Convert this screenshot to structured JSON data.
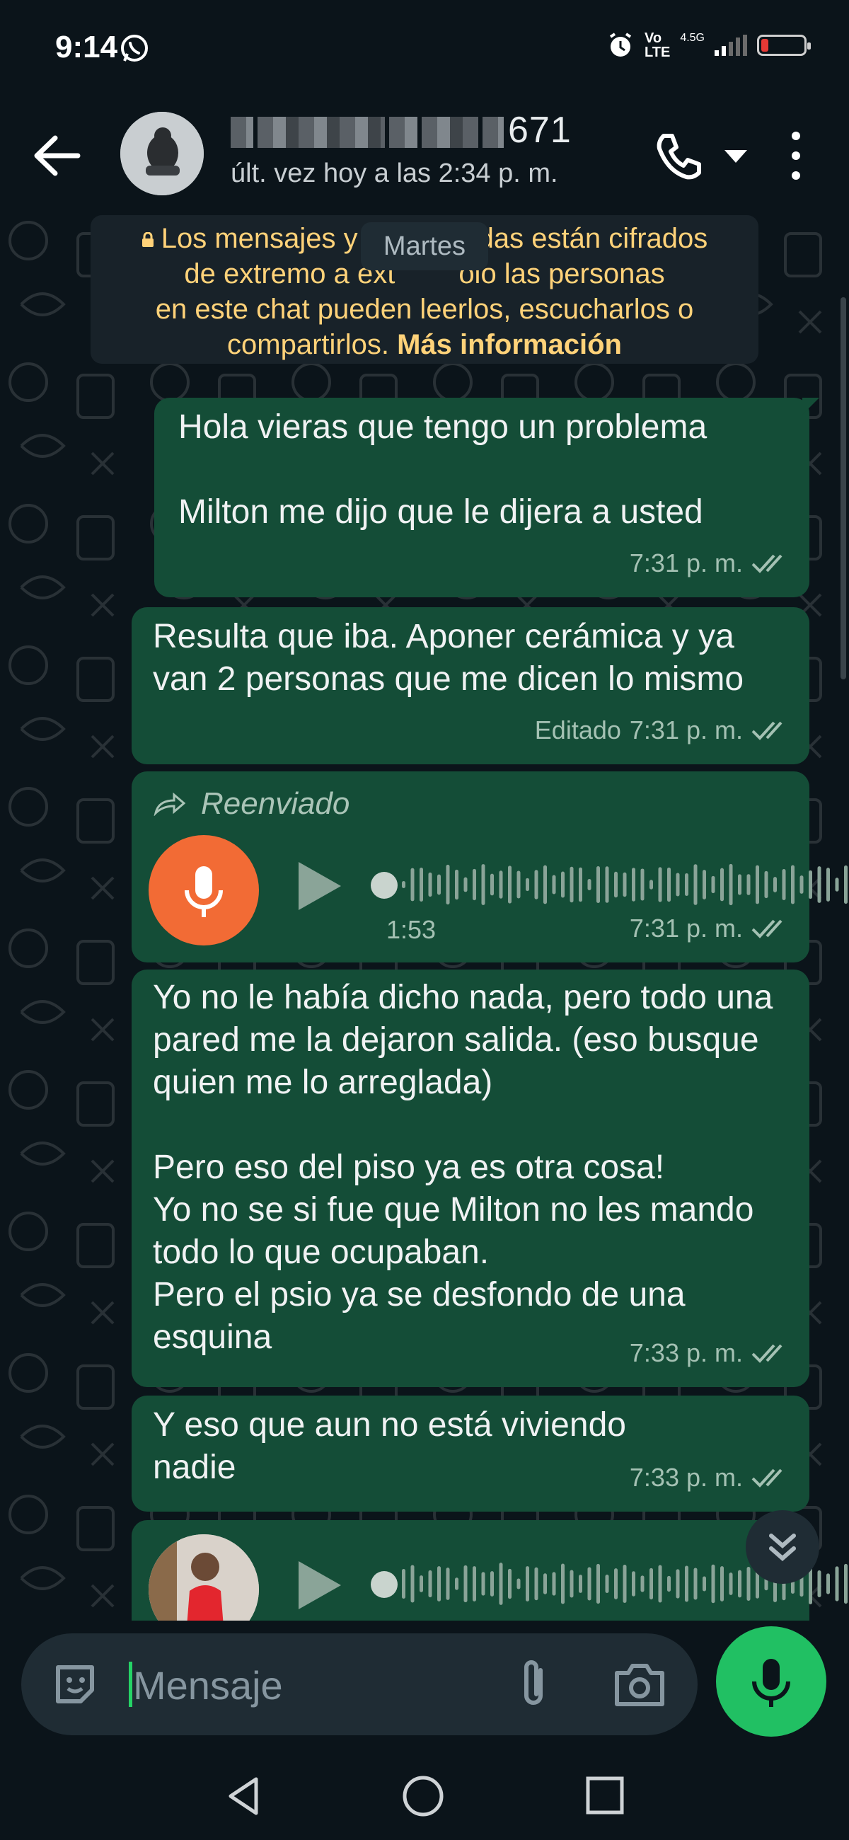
{
  "status_bar": {
    "time": "9:14",
    "volte_top": "Vo",
    "volte_bottom": "LTE",
    "network": "4.5G",
    "battery_level": 0.1
  },
  "header": {
    "contact_name_visible": "671",
    "last_seen": "últ. vez hoy a las 2:34 p. m."
  },
  "encryption_notice": {
    "line1": "Los mensajes y",
    "line1_end": "das están cifrados",
    "line2": "de extremo a ext",
    "line2_end": "olo las personas",
    "line3": "en este chat pueden leerlos, escucharlos o",
    "line4": "compartirlos.",
    "more": "Más información"
  },
  "date_pill": "Martes",
  "messages": [
    {
      "text": "Hola vieras que tengo un problema\n\nMilton me dijo que le dijera a usted",
      "time": "7:31 p. m."
    },
    {
      "text": "Resulta que iba. Aponer cerámica y ya van 2 personas que me dicen lo mismo",
      "edited": "Editado",
      "time": "7:31 p. m."
    },
    {
      "forwarded": "Reenviado",
      "duration": "1:53",
      "time": "7:31 p. m."
    },
    {
      "text": "Yo no le había dicho nada, pero todo una pared me la dejaron salida. (eso busque quien me lo arreglada)\n\nPero eso del piso ya es otra cosa!\nYo no se si fue que Milton no les mando todo lo que ocupaban.\nPero el psio ya se desfondo de una esquina",
      "time": "7:33 p. m."
    },
    {
      "text": "Y eso que aun no está viviendo nadie",
      "time": "7:33 p. m."
    }
  ],
  "input": {
    "placeholder": "Mensaje"
  },
  "colors": {
    "bubble_out": "#144d37",
    "accent_green": "#21c063",
    "voice_mic": "#f26b35",
    "notice_text": "#ffd279"
  }
}
